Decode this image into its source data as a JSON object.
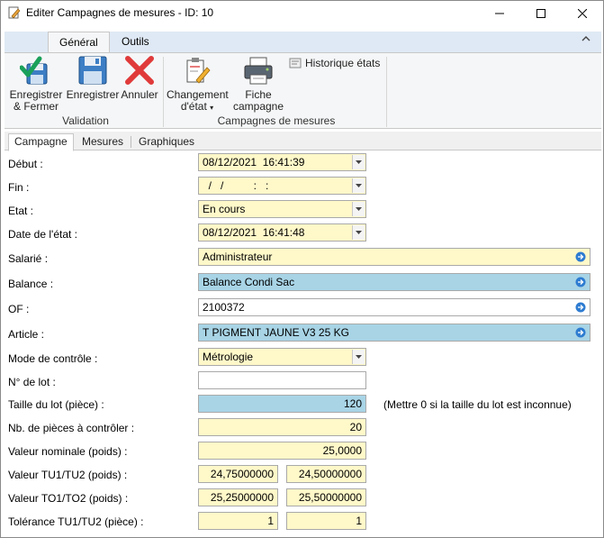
{
  "window": {
    "title": "Editer Campagnes de mesures - ID: 10"
  },
  "ribbon": {
    "tabs": [
      {
        "label": "Général"
      },
      {
        "label": "Outils"
      }
    ],
    "groups": {
      "validation": {
        "label": "Validation",
        "buttons": {
          "save_close_line1": "Enregistrer",
          "save_close_line2": "& Fermer",
          "save": "Enregistrer",
          "cancel": "Annuler"
        }
      },
      "campagnes": {
        "label": "Campagnes de mesures",
        "buttons": {
          "state_change_line1": "Changement",
          "state_change_line2": "d'état",
          "sheet_line1": "Fiche",
          "sheet_line2": "campagne",
          "history": "Historique états"
        }
      }
    }
  },
  "form_tabs": [
    {
      "label": "Campagne"
    },
    {
      "label": "Mesures"
    },
    {
      "label": "Graphiques"
    }
  ],
  "form": {
    "debut": {
      "label": "Début :",
      "value": "08/12/2021  16:41:39"
    },
    "fin": {
      "label": "Fin :",
      "value": "  /   /          :   :"
    },
    "etat": {
      "label": "Etat :",
      "value": "En cours"
    },
    "date_etat": {
      "label": "Date de l'état :",
      "value": "08/12/2021  16:41:48"
    },
    "salarie": {
      "label": "Salarié :",
      "value": "Administrateur"
    },
    "balance": {
      "label": "Balance :",
      "value": "Balance Condi Sac"
    },
    "of": {
      "label": "OF :",
      "value": "2100372"
    },
    "article": {
      "label": "Article :",
      "value": "T PIGMENT JAUNE V3 25 KG"
    },
    "mode_controle": {
      "label": "Mode de contrôle :",
      "value": "Métrologie"
    },
    "num_lot": {
      "label": "N° de lot :",
      "value": ""
    },
    "taille_lot": {
      "label": "Taille du lot (pièce) :",
      "value": "120",
      "note": "(Mettre 0 si la taille du lot est inconnue)"
    },
    "nb_pieces": {
      "label": "Nb. de pièces à contrôler :",
      "value": "20"
    },
    "valeur_nominale": {
      "label": "Valeur nominale (poids) :",
      "value": "25,0000"
    },
    "valeur_tu": {
      "label": "Valeur TU1/TU2 (poids) :",
      "value1": "24,75000000",
      "value2": "24,50000000"
    },
    "valeur_to": {
      "label": "Valeur TO1/TO2 (poids) :",
      "value1": "25,25000000",
      "value2": "25,50000000"
    },
    "tolerance": {
      "label": "Tolérance TU1/TU2 (pièce) :",
      "value1": "1",
      "value2": "1"
    }
  },
  "colors": {
    "required_field": "#fff8c9",
    "linked_field": "#a8d4e6",
    "ribbon_bg": "#f5f6f7",
    "accent_blue": "#2e7cd1"
  }
}
